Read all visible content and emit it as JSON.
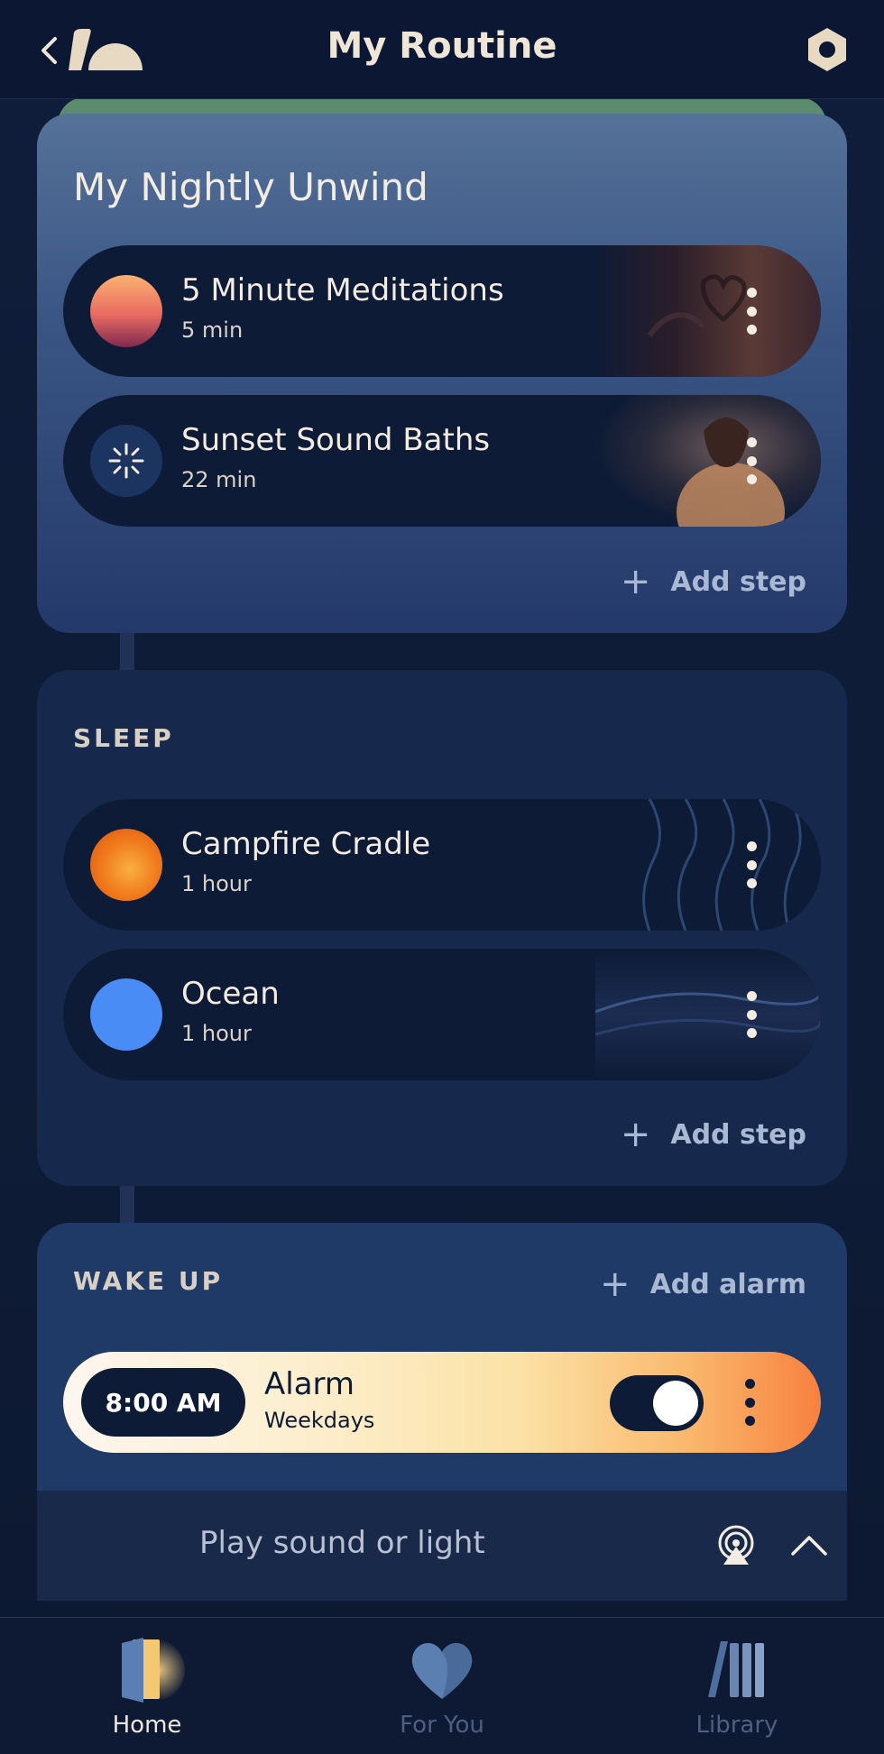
{
  "header": {
    "title": "My Routine",
    "back_icon": "chevron-left-icon",
    "logo_icon": "hatch-logo-icon",
    "settings_icon": "hexagon-settings-icon"
  },
  "routine": {
    "title": "My Nightly Unwind",
    "steps": [
      {
        "name": "5 Minute Meditations",
        "duration": "5 min",
        "icon": "sunset-gradient-dot"
      },
      {
        "name": "Sunset Sound Baths",
        "duration": "22 min",
        "icon": "sparkle-icon"
      }
    ],
    "add_step_label": "Add step"
  },
  "sleep": {
    "label": "SLEEP",
    "steps": [
      {
        "name": "Campfire Cradle",
        "duration": "1 hour",
        "icon": "campfire-orange-dot"
      },
      {
        "name": "Ocean",
        "duration": "1 hour",
        "icon": "ocean-blue-dot"
      }
    ],
    "add_step_label": "Add step"
  },
  "wake_up": {
    "label": "WAKE UP",
    "add_alarm_label": "Add alarm",
    "alarm": {
      "time": "8:00 AM",
      "name": "Alarm",
      "days": "Weekdays",
      "enabled": true
    }
  },
  "player": {
    "label": "Play sound or light",
    "airplay_icon": "airplay-icon",
    "expand_icon": "chevron-up-icon"
  },
  "nav": {
    "items": [
      {
        "label": "Home",
        "icon": "door-icon",
        "active": true
      },
      {
        "label": "For You",
        "icon": "heart-icon",
        "active": false
      },
      {
        "label": "Library",
        "icon": "library-books-icon",
        "active": false
      }
    ]
  },
  "colors": {
    "background": "#0f1c38",
    "card_routine_top": "#557299",
    "card_sleep": "#16284b",
    "card_wake": "#1f3a66",
    "step_bg": "#0e1b36",
    "ocean_dot": "#4a8cf6",
    "campfire_dot": "#f07a1c",
    "accent_text": "#a9b8d3"
  }
}
